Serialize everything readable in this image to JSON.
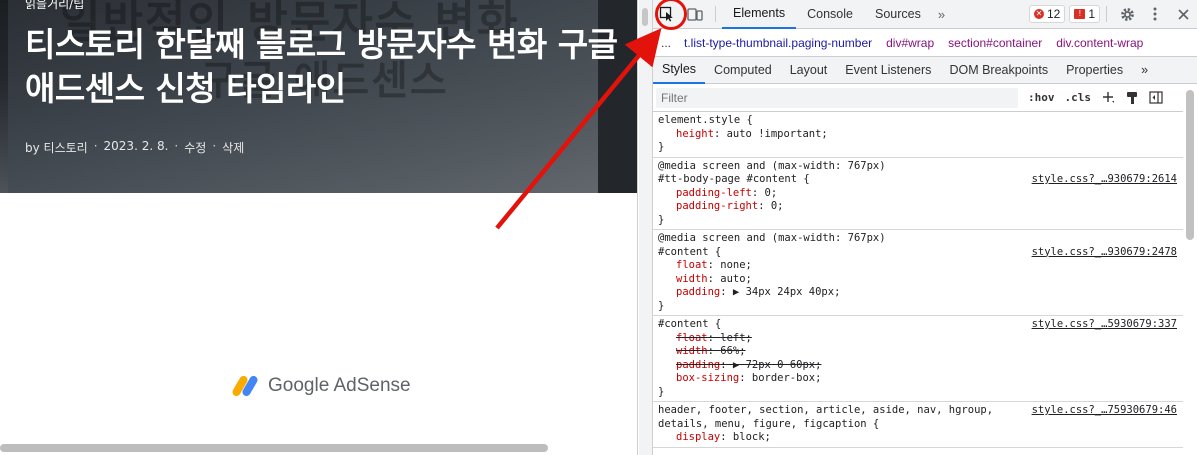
{
  "blog": {
    "category": "읽을거리/팁",
    "hero_ghost_line1": "일반적인 방문자수 변화",
    "hero_ghost_line2": "구글 애드센스",
    "title": "티스토리 한달째 블로그 방문자수 변화 구글 애드센스 신청 타임라인",
    "meta": {
      "author": "by 티스토리",
      "date": "2023. 2. 8.",
      "edit": "수정",
      "delete": "삭제",
      "separator": "·"
    },
    "ad_label": "Google AdSense"
  },
  "devtools": {
    "tabs": [
      "Elements",
      "Console",
      "Sources"
    ],
    "active_tab": "Elements",
    "more_tabs": "»",
    "errors_count": "12",
    "issues_count": "1",
    "breadcrumb_ellipsis": "...",
    "breadcrumbs": [
      "t.list-type-thumbnail.paging-number",
      "div#wrap",
      "section#container",
      "div.content-wrap"
    ],
    "subtabs": [
      "Styles",
      "Computed",
      "Layout",
      "Event Listeners",
      "DOM Breakpoints",
      "Properties"
    ],
    "active_subtab": "Styles",
    "filter_placeholder": "Filter",
    "hov_label": ":hov",
    "cls_label": ".cls",
    "rules": [
      {
        "selector": "element.style {",
        "source": "",
        "props": [
          {
            "name": "height",
            "value": "auto !important;",
            "struck": false
          }
        ]
      },
      {
        "media": "@media screen and (max-width: 767px)",
        "selector": "#tt-body-page #content {",
        "source": "style.css?_…930679:2614",
        "props": [
          {
            "name": "padding-left",
            "value": "0;",
            "struck": false
          },
          {
            "name": "padding-right",
            "value": "0;",
            "struck": false
          }
        ]
      },
      {
        "media": "@media screen and (max-width: 767px)",
        "selector": "#content {",
        "source": "style.css?_…930679:2478",
        "props": [
          {
            "name": "float",
            "value": "none;",
            "struck": false
          },
          {
            "name": "width",
            "value": "auto;",
            "struck": false
          },
          {
            "name": "padding",
            "value": "▶ 34px 24px 40px;",
            "struck": false
          }
        ]
      },
      {
        "selector": "#content {",
        "source": "style.css?_…5930679:337",
        "props": [
          {
            "name": "float",
            "value": "left;",
            "struck": true
          },
          {
            "name": "width",
            "value": "66%;",
            "struck": true
          },
          {
            "name": "padding",
            "value": "▶ 72px 0 60px;",
            "struck": true
          },
          {
            "name": "box-sizing",
            "value": "border-box;",
            "struck": false
          }
        ]
      },
      {
        "selector": "header, footer, section, article, aside, nav, hgroup,",
        "selector2": "details, menu, figure, figcaption {",
        "source": "style.css?_…75930679:46",
        "props": [
          {
            "name": "display",
            "value": "block;",
            "struck": false
          }
        ]
      }
    ]
  },
  "colors": {
    "accent": "#1a73e8",
    "annotation_red": "#e3120b",
    "css_prop": "#c80000",
    "breadcrumb_tag": "#881280"
  }
}
